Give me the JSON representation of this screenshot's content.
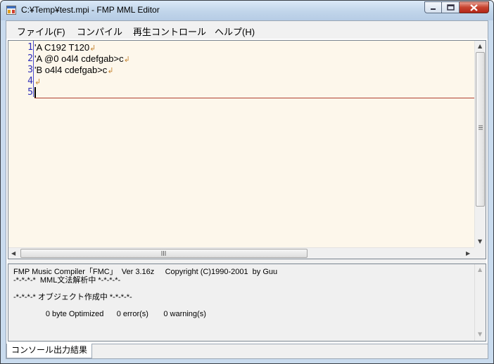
{
  "window": {
    "title": "C:¥Temp¥test.mpi - FMP MML Editor"
  },
  "menu": [
    "ファイル(F)",
    "コンパイル",
    "再生コントロール",
    "ヘルプ(H)"
  ],
  "editor": {
    "line_numbers": [
      "1",
      "2",
      "3",
      "4",
      "5"
    ],
    "lines": [
      "'A C192 T120",
      "'A @0 o4l4 cdefgab>c",
      "'B o4l4 cdefgab>c",
      "",
      ""
    ],
    "eol_mark": "↲",
    "colors": {
      "background": "#fdf7eb",
      "line_numbers": "#2f2fb8",
      "eol_mark": "#c88a3a",
      "current_line": "#b04030"
    }
  },
  "console": {
    "lines": [
      "FMP Music Compiler「FMC」  Ver 3.16z     Copyright (C)1990-2001  by Guu",
      "-*-*-*-*  MML文法解析中 *-*-*-*-",
      "",
      "-*-*-*-* オブジェクト作成中 *-*-*-*-",
      "",
      "               0 byte Optimized      0 error(s)       0 warning(s)"
    ]
  },
  "tabs": [
    "コンソール出力結果"
  ],
  "icons": {
    "app": "app-window-icon",
    "minimize": "minimize-icon",
    "maximize": "maximize-icon",
    "close": "close-icon",
    "scroll_up": "scroll-up-arrow-icon",
    "scroll_down": "scroll-down-arrow-icon",
    "scroll_left": "scroll-left-arrow-icon",
    "scroll_right": "scroll-right-arrow-icon"
  }
}
